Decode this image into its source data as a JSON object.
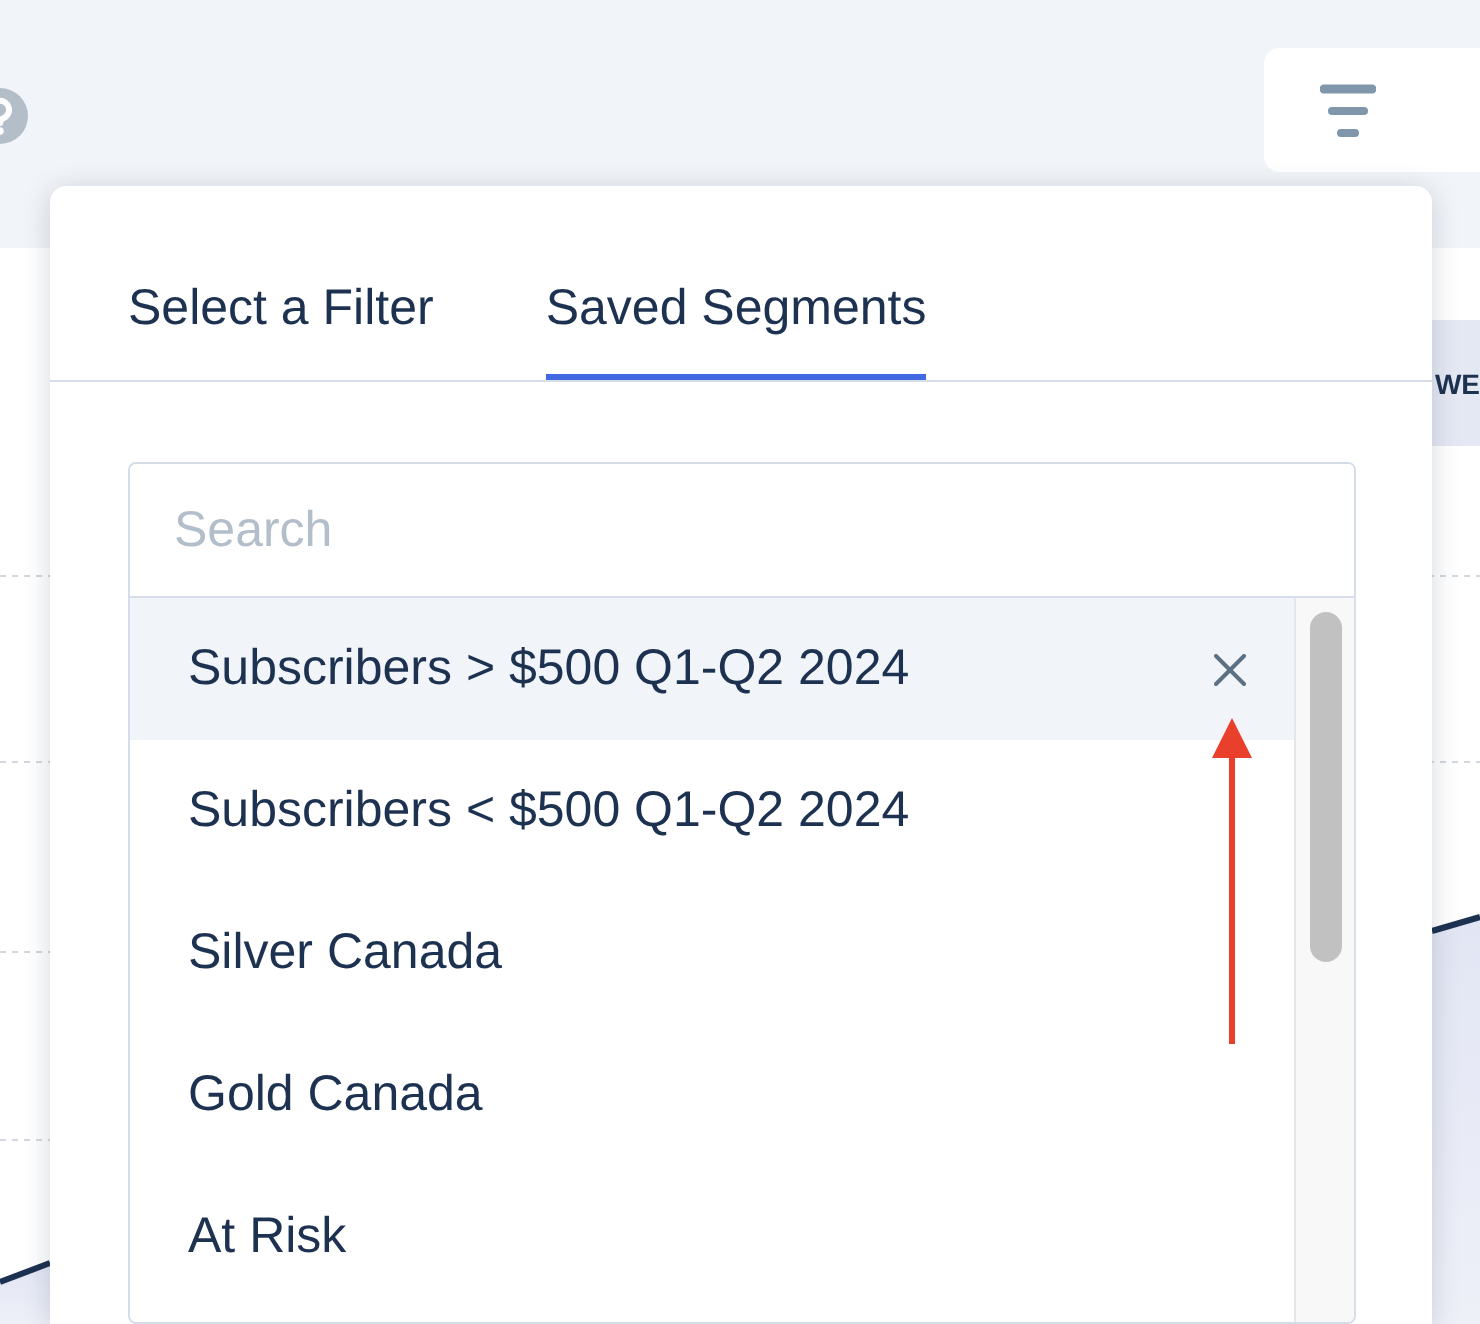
{
  "background": {
    "column_header": "WE"
  },
  "popover": {
    "tabs": [
      {
        "label": "Select a Filter",
        "selected": false
      },
      {
        "label": "Saved Segments",
        "selected": true
      }
    ],
    "search": {
      "placeholder": "Search"
    },
    "segments": [
      {
        "name": "Subscribers > $500 Q1-Q2 2024",
        "selected": true
      },
      {
        "name": "Subscribers < $500 Q1-Q2 2024",
        "selected": false
      },
      {
        "name": "Silver Canada",
        "selected": false
      },
      {
        "name": "Gold Canada",
        "selected": false
      },
      {
        "name": "At Risk",
        "selected": false
      }
    ]
  }
}
